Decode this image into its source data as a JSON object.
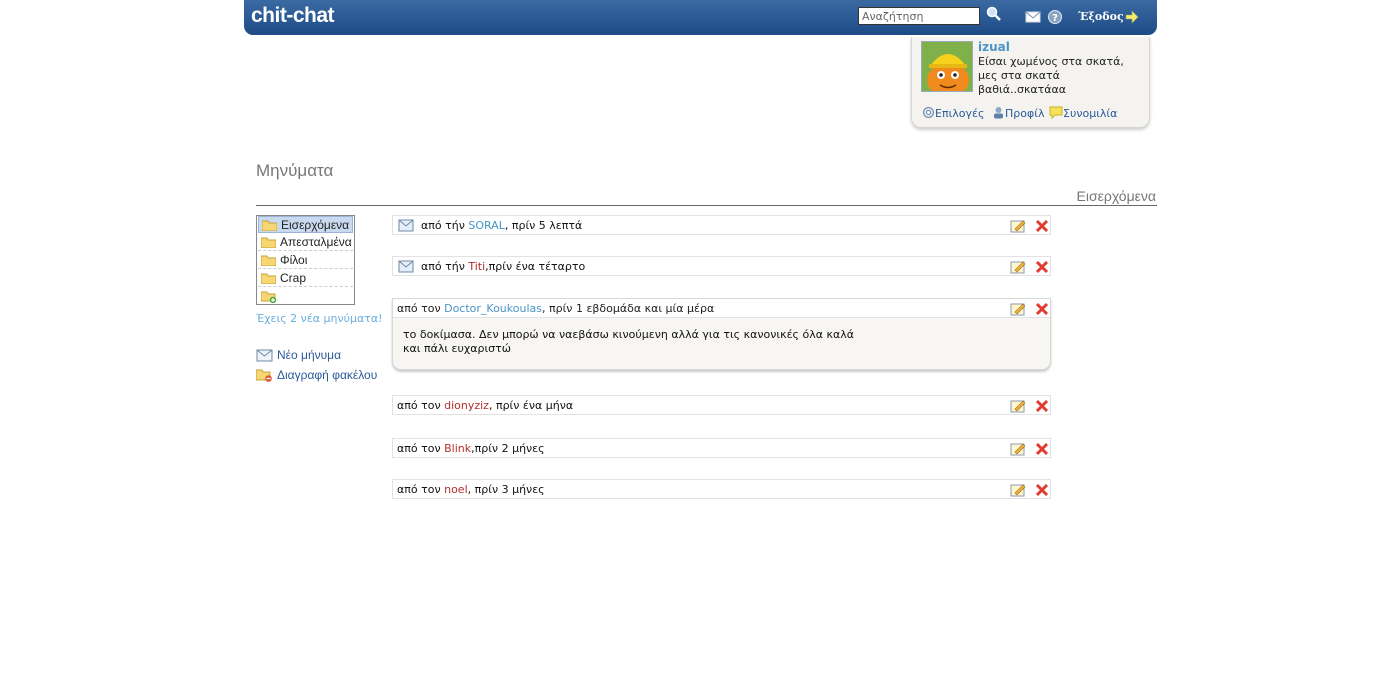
{
  "header": {
    "logo": "chit-chat",
    "search_placeholder": "Αναζήτηση",
    "logout": "Έξοδος"
  },
  "profile": {
    "username": "izual",
    "status_lines": [
      "Είσαι χωμένος στα σκατά,",
      "μες στα σκατά",
      "βαθιά..σκατάαα"
    ],
    "links": {
      "options": "Επιλογές",
      "profile": "Προφίλ",
      "chat": "Συνομιλία"
    }
  },
  "page": {
    "title": "Μηνύματα",
    "folder_title": "Εισερχόμενα"
  },
  "folders": {
    "items": [
      "Εισερχόμενα",
      "Απεσταλμένα",
      "Φίλοι",
      "Crap"
    ],
    "selected": "Εισερχόμενα"
  },
  "sidebar": {
    "new_messages": "Έχεις 2 νέα μηνύματα!",
    "new_message": "Νέο μήνυμα",
    "delete_folder": "Διαγραφή φακέλου"
  },
  "messages": [
    {
      "prefix": "από τήν ",
      "sender": "SORAL",
      "suffix": ", πρίν 5 λεπτά",
      "unread": true
    },
    {
      "prefix": "από τήν ",
      "sender": "Titi",
      "suffix": ",πρίν ένα τέταρτο",
      "unread": true
    },
    {
      "prefix": "από τον ",
      "sender": "Doctor_Koukoulas",
      "suffix": ", πρίν 1 εβδομάδα και μία μέρα",
      "unread": false,
      "body_lines": [
        "το δοκίμασα. Δεν μπορώ να ναεβάσω κινούμενη αλλά για τις κανονικές όλα καλά",
        "και πάλι ευχαριστώ"
      ]
    },
    {
      "prefix": "από τον ",
      "sender": "dionyziz",
      "suffix": ", πρίν ένα μήνα",
      "unread": false
    },
    {
      "prefix": "από τον ",
      "sender": "Blink",
      "suffix": ",πρίν 2 μήνες",
      "unread": false
    },
    {
      "prefix": "από τον ",
      "sender": "noel",
      "suffix": ", πρίν 3 μήνες",
      "unread": false
    }
  ],
  "colors": {
    "header_bar": "#2b5a95",
    "link_blue": "#4a94c7",
    "sender_red": "#b0302c"
  }
}
